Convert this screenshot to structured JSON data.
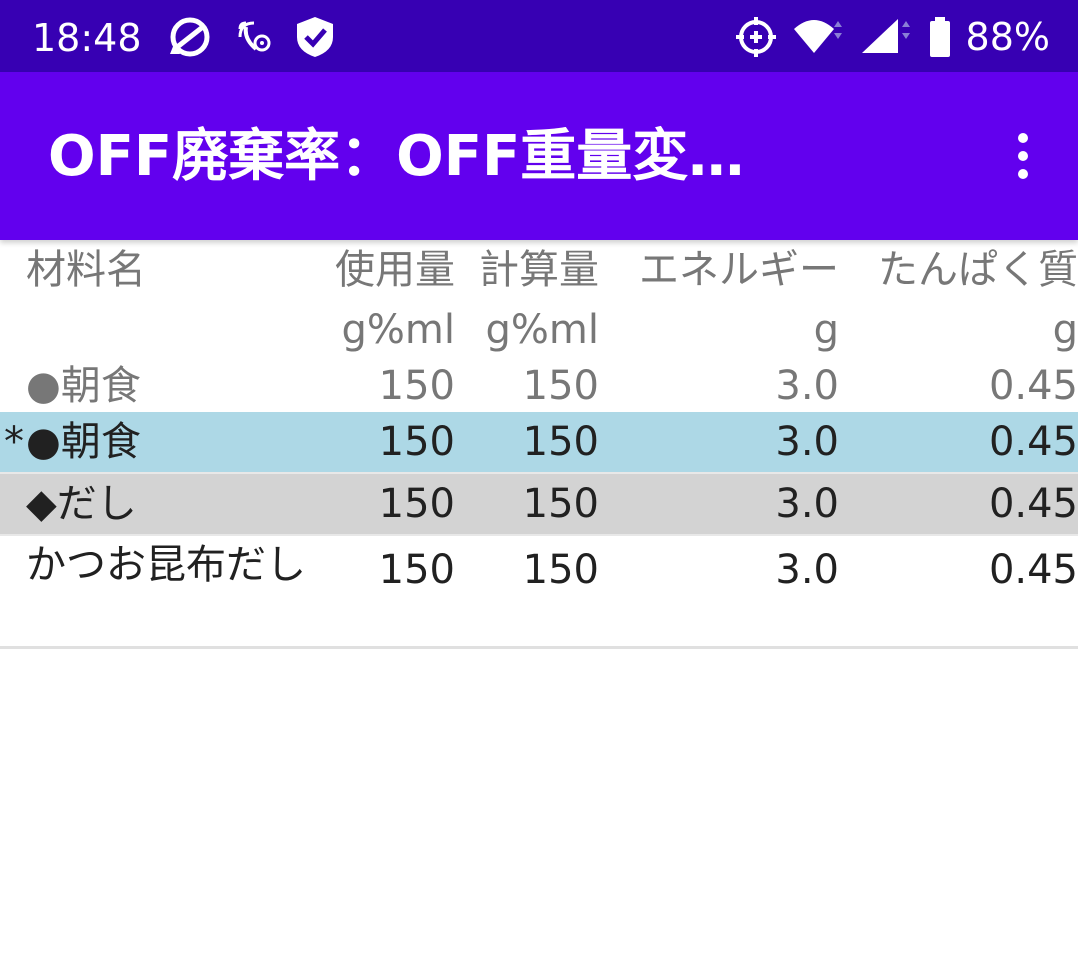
{
  "status_bar": {
    "time": "18:48",
    "battery_percent": "88%",
    "icons_left": [
      "sync-circle-icon",
      "nfc-settings-icon",
      "shield-check-icon"
    ],
    "icons_right": [
      "location-target-icon",
      "wifi-icon",
      "cell-signal-icon",
      "battery-icon"
    ]
  },
  "app_bar": {
    "title": "OFF廃棄率：OFF重量変…",
    "menu_icon": "more-vert-icon"
  },
  "colors": {
    "status_bar": "#3700b3",
    "app_bar": "#6200ee",
    "selected_row": "#add8e6",
    "group_row": "#d3d3d3",
    "muted_text": "#777777",
    "text": "#212121"
  },
  "table": {
    "headers": [
      "材料名",
      "使用量",
      "計算量",
      "エネルギー",
      "たんぱく質"
    ],
    "units": [
      "",
      "g%ml",
      "g%ml",
      "g",
      "g"
    ],
    "rows": [
      {
        "mark": "",
        "name": "●朝食",
        "use": "150",
        "calc": "150",
        "energy": "3.0",
        "protein": "0.45"
      },
      {
        "mark": "*",
        "name": "●朝食",
        "use": "150",
        "calc": "150",
        "energy": "3.0",
        "protein": "0.45"
      },
      {
        "mark": "",
        "name": "◆だし",
        "use": "150",
        "calc": "150",
        "energy": "3.0",
        "protein": "0.45"
      },
      {
        "mark": "",
        "name": "かつお昆布だし",
        "use": "150",
        "calc": "150",
        "energy": "3.0",
        "protein": "0.45"
      }
    ]
  }
}
